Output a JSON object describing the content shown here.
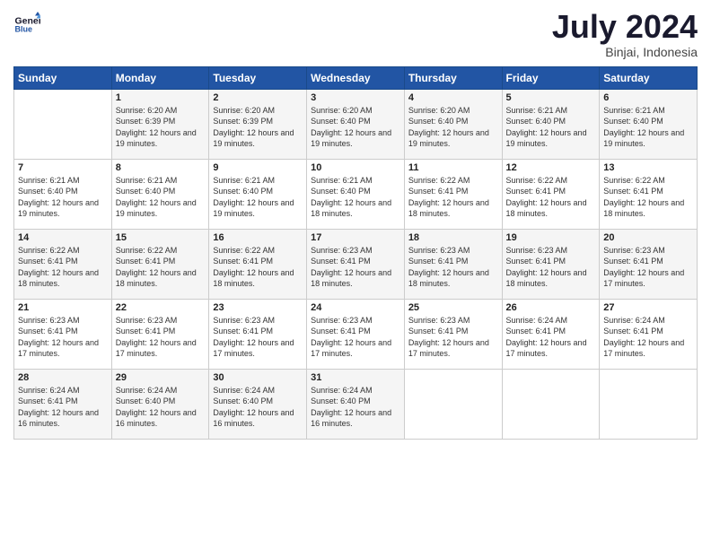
{
  "header": {
    "logo_line1": "General",
    "logo_line2": "Blue",
    "title": "July 2024",
    "location": "Binjai, Indonesia"
  },
  "days_of_week": [
    "Sunday",
    "Monday",
    "Tuesday",
    "Wednesday",
    "Thursday",
    "Friday",
    "Saturday"
  ],
  "weeks": [
    [
      {
        "day": "",
        "info": ""
      },
      {
        "day": "1",
        "info": "Sunrise: 6:20 AM\nSunset: 6:39 PM\nDaylight: 12 hours\nand 19 minutes."
      },
      {
        "day": "2",
        "info": "Sunrise: 6:20 AM\nSunset: 6:39 PM\nDaylight: 12 hours\nand 19 minutes."
      },
      {
        "day": "3",
        "info": "Sunrise: 6:20 AM\nSunset: 6:40 PM\nDaylight: 12 hours\nand 19 minutes."
      },
      {
        "day": "4",
        "info": "Sunrise: 6:20 AM\nSunset: 6:40 PM\nDaylight: 12 hours\nand 19 minutes."
      },
      {
        "day": "5",
        "info": "Sunrise: 6:21 AM\nSunset: 6:40 PM\nDaylight: 12 hours\nand 19 minutes."
      },
      {
        "day": "6",
        "info": "Sunrise: 6:21 AM\nSunset: 6:40 PM\nDaylight: 12 hours\nand 19 minutes."
      }
    ],
    [
      {
        "day": "7",
        "info": "Sunrise: 6:21 AM\nSunset: 6:40 PM\nDaylight: 12 hours\nand 19 minutes."
      },
      {
        "day": "8",
        "info": "Sunrise: 6:21 AM\nSunset: 6:40 PM\nDaylight: 12 hours\nand 19 minutes."
      },
      {
        "day": "9",
        "info": "Sunrise: 6:21 AM\nSunset: 6:40 PM\nDaylight: 12 hours\nand 19 minutes."
      },
      {
        "day": "10",
        "info": "Sunrise: 6:21 AM\nSunset: 6:40 PM\nDaylight: 12 hours\nand 18 minutes."
      },
      {
        "day": "11",
        "info": "Sunrise: 6:22 AM\nSunset: 6:41 PM\nDaylight: 12 hours\nand 18 minutes."
      },
      {
        "day": "12",
        "info": "Sunrise: 6:22 AM\nSunset: 6:41 PM\nDaylight: 12 hours\nand 18 minutes."
      },
      {
        "day": "13",
        "info": "Sunrise: 6:22 AM\nSunset: 6:41 PM\nDaylight: 12 hours\nand 18 minutes."
      }
    ],
    [
      {
        "day": "14",
        "info": "Sunrise: 6:22 AM\nSunset: 6:41 PM\nDaylight: 12 hours\nand 18 minutes."
      },
      {
        "day": "15",
        "info": "Sunrise: 6:22 AM\nSunset: 6:41 PM\nDaylight: 12 hours\nand 18 minutes."
      },
      {
        "day": "16",
        "info": "Sunrise: 6:22 AM\nSunset: 6:41 PM\nDaylight: 12 hours\nand 18 minutes."
      },
      {
        "day": "17",
        "info": "Sunrise: 6:23 AM\nSunset: 6:41 PM\nDaylight: 12 hours\nand 18 minutes."
      },
      {
        "day": "18",
        "info": "Sunrise: 6:23 AM\nSunset: 6:41 PM\nDaylight: 12 hours\nand 18 minutes."
      },
      {
        "day": "19",
        "info": "Sunrise: 6:23 AM\nSunset: 6:41 PM\nDaylight: 12 hours\nand 18 minutes."
      },
      {
        "day": "20",
        "info": "Sunrise: 6:23 AM\nSunset: 6:41 PM\nDaylight: 12 hours\nand 17 minutes."
      }
    ],
    [
      {
        "day": "21",
        "info": "Sunrise: 6:23 AM\nSunset: 6:41 PM\nDaylight: 12 hours\nand 17 minutes."
      },
      {
        "day": "22",
        "info": "Sunrise: 6:23 AM\nSunset: 6:41 PM\nDaylight: 12 hours\nand 17 minutes."
      },
      {
        "day": "23",
        "info": "Sunrise: 6:23 AM\nSunset: 6:41 PM\nDaylight: 12 hours\nand 17 minutes."
      },
      {
        "day": "24",
        "info": "Sunrise: 6:23 AM\nSunset: 6:41 PM\nDaylight: 12 hours\nand 17 minutes."
      },
      {
        "day": "25",
        "info": "Sunrise: 6:23 AM\nSunset: 6:41 PM\nDaylight: 12 hours\nand 17 minutes."
      },
      {
        "day": "26",
        "info": "Sunrise: 6:24 AM\nSunset: 6:41 PM\nDaylight: 12 hours\nand 17 minutes."
      },
      {
        "day": "27",
        "info": "Sunrise: 6:24 AM\nSunset: 6:41 PM\nDaylight: 12 hours\nand 17 minutes."
      }
    ],
    [
      {
        "day": "28",
        "info": "Sunrise: 6:24 AM\nSunset: 6:41 PM\nDaylight: 12 hours\nand 16 minutes."
      },
      {
        "day": "29",
        "info": "Sunrise: 6:24 AM\nSunset: 6:40 PM\nDaylight: 12 hours\nand 16 minutes."
      },
      {
        "day": "30",
        "info": "Sunrise: 6:24 AM\nSunset: 6:40 PM\nDaylight: 12 hours\nand 16 minutes."
      },
      {
        "day": "31",
        "info": "Sunrise: 6:24 AM\nSunset: 6:40 PM\nDaylight: 12 hours\nand 16 minutes."
      },
      {
        "day": "",
        "info": ""
      },
      {
        "day": "",
        "info": ""
      },
      {
        "day": "",
        "info": ""
      }
    ]
  ]
}
